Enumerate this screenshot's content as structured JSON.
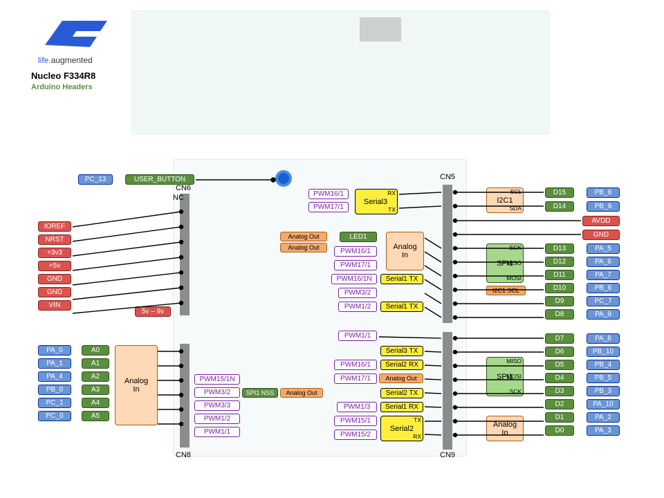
{
  "logo": {
    "brand": "ST",
    "tag_prefix": "life",
    "tag_dot": ".",
    "tag_suffix": "augmented"
  },
  "title": "Nucleo F334R8",
  "subtitle": "Arduino Headers",
  "conn": {
    "cn5": "CN5",
    "cn6": "CN6",
    "cn8": "CN8",
    "cn9": "CN9",
    "nc": "NC"
  },
  "btn": {
    "pin": "PC_13",
    "label": "USER_BUTTON"
  },
  "range": "5v – 9v",
  "power": [
    "IOREF",
    "NRST",
    "+3v3",
    "+5v",
    "GND",
    "GND",
    "VIN"
  ],
  "analog_pins": [
    "PA_0",
    "PA_1",
    "PA_4",
    "PB_0",
    "PC_1",
    "PC_0"
  ],
  "analog_lbls": [
    "A0",
    "A1",
    "A2",
    "A3",
    "A4",
    "A5"
  ],
  "analog_in": "Analog\nIn",
  "cn8_pwm": [
    "PWM15/1N",
    "PWM3/2",
    "PWM3/3",
    "PWM1/2",
    "PWM1/1"
  ],
  "spi1_nss": "SPI1 NSS",
  "analog_out": "Analog Out",
  "ao_top": [
    "Analog Out",
    "Analog Out"
  ],
  "pwm_mid_top": [
    "PWM16/1",
    "PWM17/1"
  ],
  "serial3_top": {
    "name": "Serial3",
    "rx": "RX",
    "tx": "TX"
  },
  "mid_col": [
    "LED1",
    "PWM16/1",
    "PWM17/1",
    "PWM16/1N",
    "PWM3/2",
    "PWM1/2"
  ],
  "serial1tx_a": "Serial1 TX",
  "serial1tx_b": "Serial1 TX",
  "analog_in_top": "Analog\nIn",
  "pwm_mid_bot": [
    "PWM1/1",
    "PWM16/1",
    "PWM17/1",
    "PWM1/3",
    "PWM15/1",
    "PWM15/2"
  ],
  "serial_mid_bot": [
    "Serial3 TX",
    "Serial2 RX",
    "Serial2 TX",
    "Serial1 RX"
  ],
  "serial2_bot": {
    "name": "Serial2",
    "tx": "TX",
    "rx": "RX"
  },
  "ao_bot": "Analog Out",
  "i2c1_top": {
    "name": "I2C1",
    "scl": "SCL",
    "sda": "SDA"
  },
  "cn5_green": [
    "D15",
    "D14"
  ],
  "cn5_blue": [
    "PB_8",
    "PB_9"
  ],
  "cn5_mid_r": [
    "AVDD",
    "GND"
  ],
  "spi1_top": {
    "name": "SPI1",
    "l1": "SCK",
    "l2": "MISO",
    "l3": "MOSI"
  },
  "i2c1_scl": "I2C1 SCL",
  "cn5_green2": [
    "D13",
    "D12",
    "D11",
    "D10",
    "D9",
    "D8"
  ],
  "cn5_blue2": [
    "PA_5",
    "PA_6",
    "PA_7",
    "PB_6",
    "PC_7",
    "PA_9"
  ],
  "cn9_green": [
    "D7",
    "D6",
    "D5",
    "D4",
    "D3",
    "D2",
    "D1",
    "D0"
  ],
  "cn9_blue": [
    "PA_8",
    "PB_10",
    "PB_4",
    "PB_5",
    "PB_3",
    "PA_10",
    "PA_2",
    "PA_3"
  ],
  "spi1_bot": {
    "name": "SPI1",
    "l1": "MISO",
    "l2": "MOSI",
    "l3": "SCK"
  },
  "analog_in_bot": "Analog\nIn"
}
